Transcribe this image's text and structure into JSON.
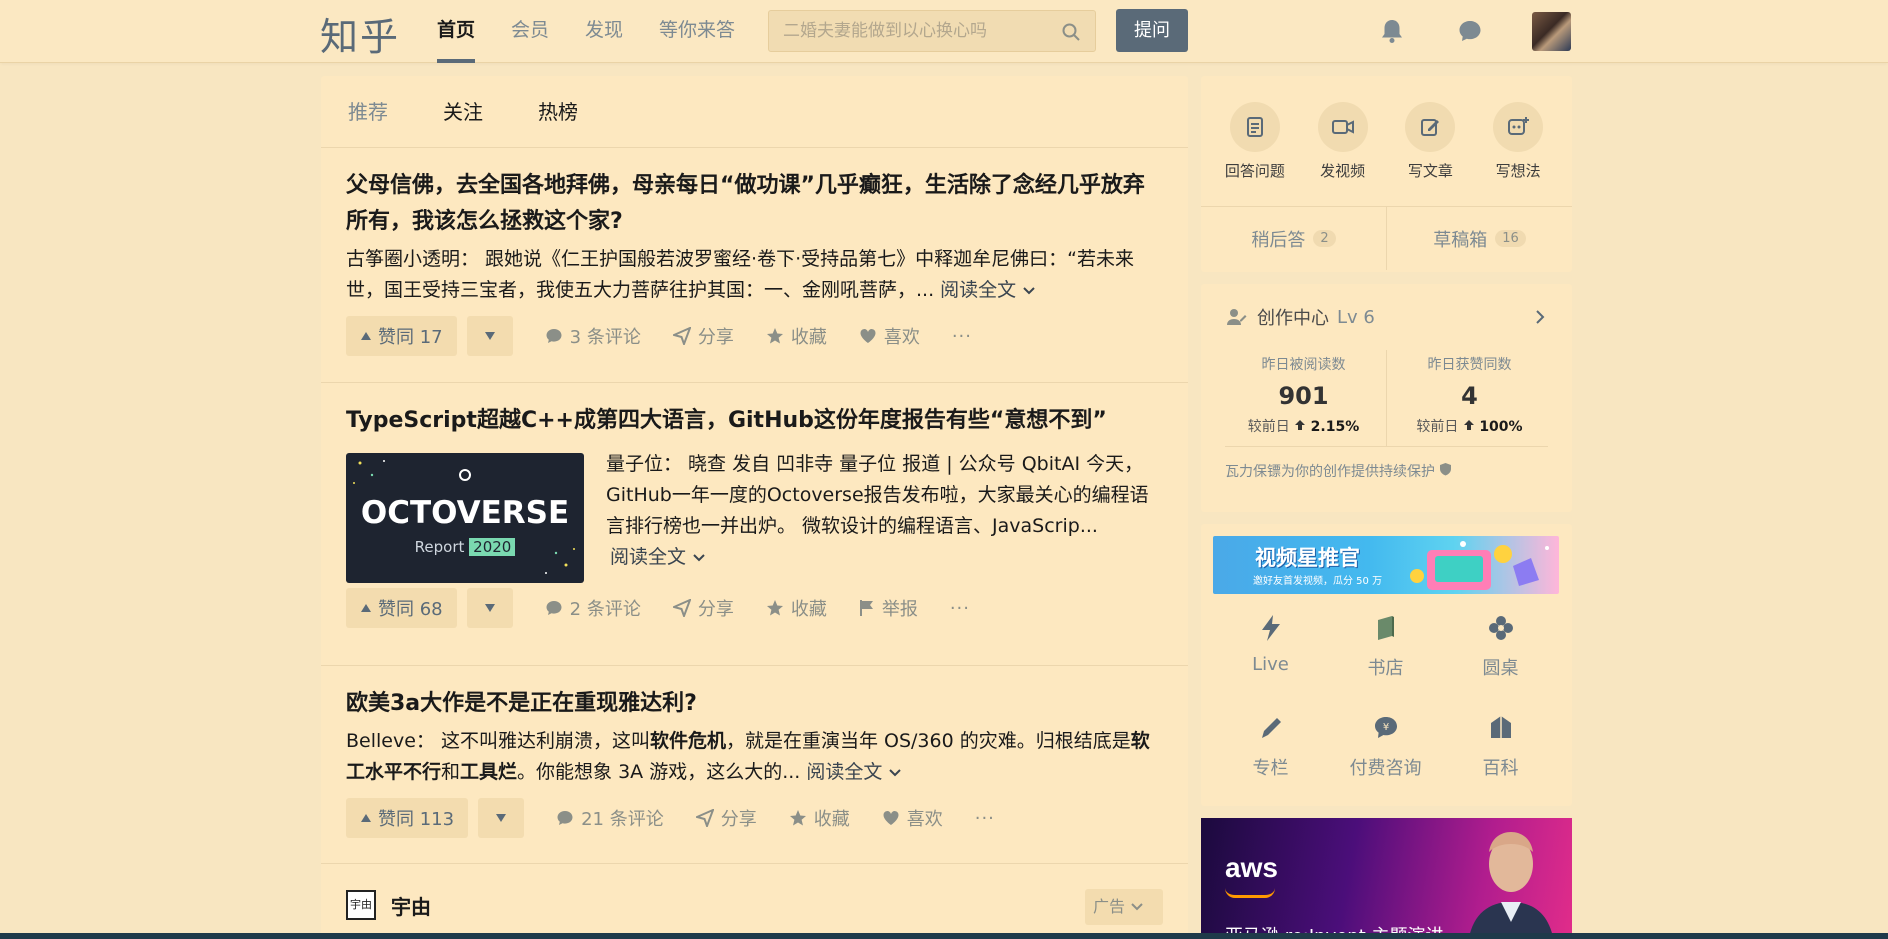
{
  "header": {
    "logo": "知乎",
    "nav": [
      "首页",
      "会员",
      "发现",
      "等你来答"
    ],
    "search_placeholder": "二婚夫妻能做到以心换心吗",
    "ask_label": "提问"
  },
  "feed": {
    "tabs": [
      "推荐",
      "关注",
      "热榜"
    ],
    "items": [
      {
        "title": "父母信佛，去全国各地拜佛，母亲每日“做功课”几乎癫狂，生活除了念经几乎放弃所有，我该怎么拯救这个家?",
        "excerpt": "古筝圈小透明：  跟她说《仁王护国般若波罗蜜经·卷下·受持品第七》中释迦牟尼佛曰：“若未来世，国王受持三宝者，我使五大力菩萨往护其国：一、金刚吼菩萨，...",
        "read_more": "阅读全文",
        "upvote": "赞同 17",
        "comments": "3 条评论",
        "share": "分享",
        "favorite": "收藏",
        "like": "喜欢"
      },
      {
        "title": "TypeScript超越C++成第四大语言，GitHub这份年度报告有些“意想不到”",
        "thumb_title": "OCTOVERSE",
        "thumb_report": "Report",
        "thumb_year": "2020",
        "excerpt": "量子位：  晓查 发自 凹非寺 量子位 报道 | 公众号 QbitAI 今天，GitHub一年一度的Octoverse报告发布啦，大家最关心的编程语言排行榜也一并出炉。 微软设计的编程语言、JavaScrip...",
        "read_more": "阅读全文",
        "upvote": "赞同 68",
        "comments": "2 条评论",
        "share": "分享",
        "favorite": "收藏",
        "report": "举报"
      },
      {
        "title": "欧美3a大作是不是正在重现雅达利?",
        "excerpt_parts": [
          "Belleve：  这不叫雅达利崩溃，这叫",
          "软件危机",
          "，就是在重演当年 OS/360 的灾难。归根结底是",
          "软工水平不行",
          "和",
          "工具烂",
          "。你能想象 3A 游戏，这么大的... "
        ],
        "read_more": "阅读全文",
        "upvote": "赞同 113",
        "comments": "21 条评论",
        "share": "分享",
        "favorite": "收藏",
        "like": "喜欢"
      }
    ],
    "ad": {
      "logo_text": "宇由",
      "brand": "宇由",
      "badge": "广告"
    }
  },
  "sidebar": {
    "quick_actions": [
      "回答问题",
      "发视频",
      "写文章",
      "写想法"
    ],
    "later_answer": {
      "label": "稍后答",
      "count": "2"
    },
    "drafts": {
      "label": "草稿箱",
      "count": "16"
    },
    "creator": {
      "title": "创作中心",
      "level": "Lv 6",
      "stats": [
        {
          "label": "昨日被阅读数",
          "value": "901",
          "cmp_prefix": "较前日",
          "cmp_value": "2.15%"
        },
        {
          "label": "昨日获赞同数",
          "value": "4",
          "cmp_prefix": "较前日",
          "cmp_value": "100%"
        }
      ],
      "protect": "瓦力保镖为你的创作提供持续保护"
    },
    "banner": {
      "title": "视频星推官",
      "subtitle": "邀好友首发视频，瓜分 50 万"
    },
    "tiles": [
      "Live",
      "书店",
      "圆桌",
      "专栏",
      "付费咨询",
      "百科"
    ],
    "aws": {
      "logo": "aws",
      "text": "亚马逊 re:Invent 主题演讲"
    }
  },
  "colors": {
    "background": "#f8e6c1",
    "card": "#fde8c0",
    "accent": "#5a6a78"
  }
}
